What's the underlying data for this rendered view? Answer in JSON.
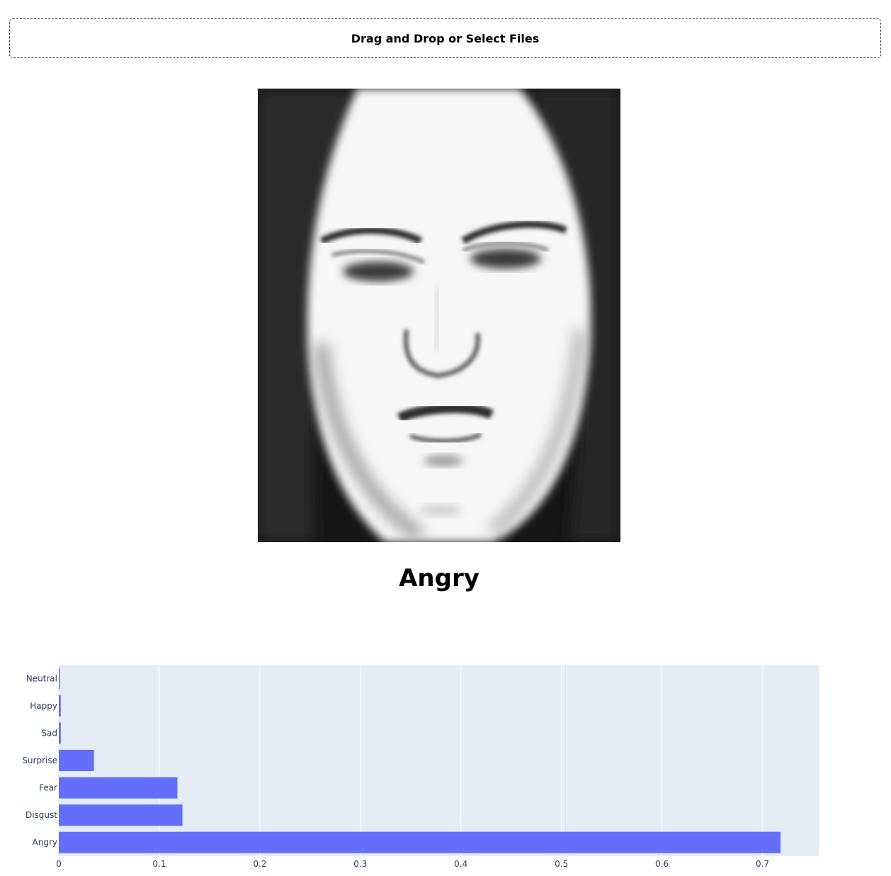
{
  "upload": {
    "label": "Drag and Drop or Select Files"
  },
  "image": {
    "description_icon": "face-photo"
  },
  "prediction": {
    "label": "Angry"
  },
  "colors": {
    "bar": "#636efa",
    "plot_bg": "#e5ecf6",
    "grid": "#ffffff",
    "tick_text": "#2a3f5f"
  },
  "chart_data": {
    "type": "bar",
    "orientation": "horizontal",
    "categories": [
      "Angry",
      "Disgust",
      "Fear",
      "Surprise",
      "Sad",
      "Happy",
      "Neutral"
    ],
    "values": [
      0.718,
      0.123,
      0.118,
      0.035,
      0.002,
      0.002,
      0.001
    ],
    "xticks": [
      "0",
      "0.1",
      "0.2",
      "0.3",
      "0.4",
      "0.5",
      "0.6",
      "0.7"
    ],
    "xlim": [
      0,
      0.756
    ],
    "grid": true
  }
}
